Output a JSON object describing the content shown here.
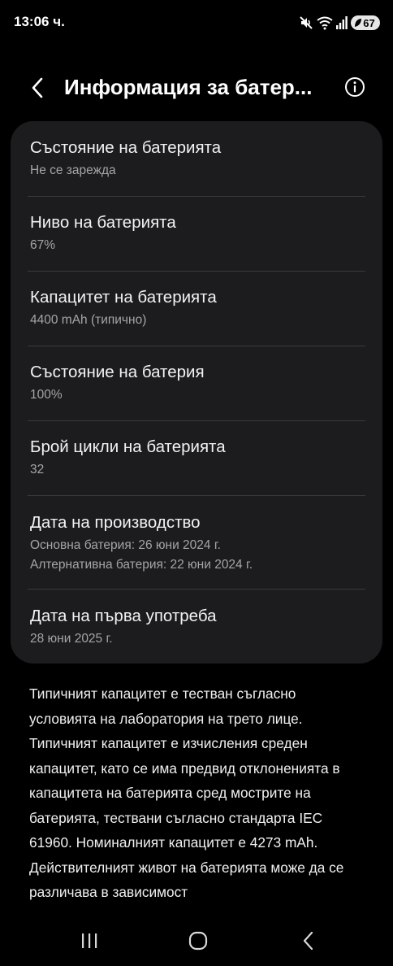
{
  "status_bar": {
    "time": "13:06 ч.",
    "battery_level": "67",
    "icons": [
      "mute-icon",
      "wifi-icon",
      "signal-icon",
      "battery-icon"
    ]
  },
  "header": {
    "title": "Информация за батер...",
    "back_icon": "chevron-left-icon",
    "info_icon": "info-icon"
  },
  "card": {
    "items": [
      {
        "title": "Състояние на батерията",
        "sub": "Не се зарежда"
      },
      {
        "title": "Ниво на батерията",
        "sub": "67%"
      },
      {
        "title": "Капацитет на батерията",
        "sub": "4400 mAh (типично)"
      },
      {
        "title": "Състояние на батерия",
        "sub": "100%"
      },
      {
        "title": "Брой цикли на батерията",
        "sub": "32"
      },
      {
        "title": "Дата на производство",
        "sub": "Основна батерия: 26 юни 2024 г.",
        "sub2": "Алтернативна батерия: 22 юни 2024 г."
      },
      {
        "title": "Дата на първа употреба",
        "sub": "28 юни 2025 г."
      }
    ]
  },
  "description": "Типичният капацитет е тестван съгласно условията на лаборатория на трето лице. Типичният капацитет е изчисления среден капацитет, като се има предвид отклоненията в капацитета на батерията сред мострите на батерията, тествани съгласно стандарта IEC 61960. Номиналният капацитет е 4273 mAh. Действителният живот на батерията може да се различава в зависимост",
  "nav_bar": {
    "icons": [
      "recent-apps-icon",
      "home-icon",
      "back-icon"
    ]
  },
  "colors": {
    "background": "#000000",
    "card": "#1c1c1e",
    "divider": "#3a3a3c",
    "secondary_text": "#a5a5a5"
  }
}
